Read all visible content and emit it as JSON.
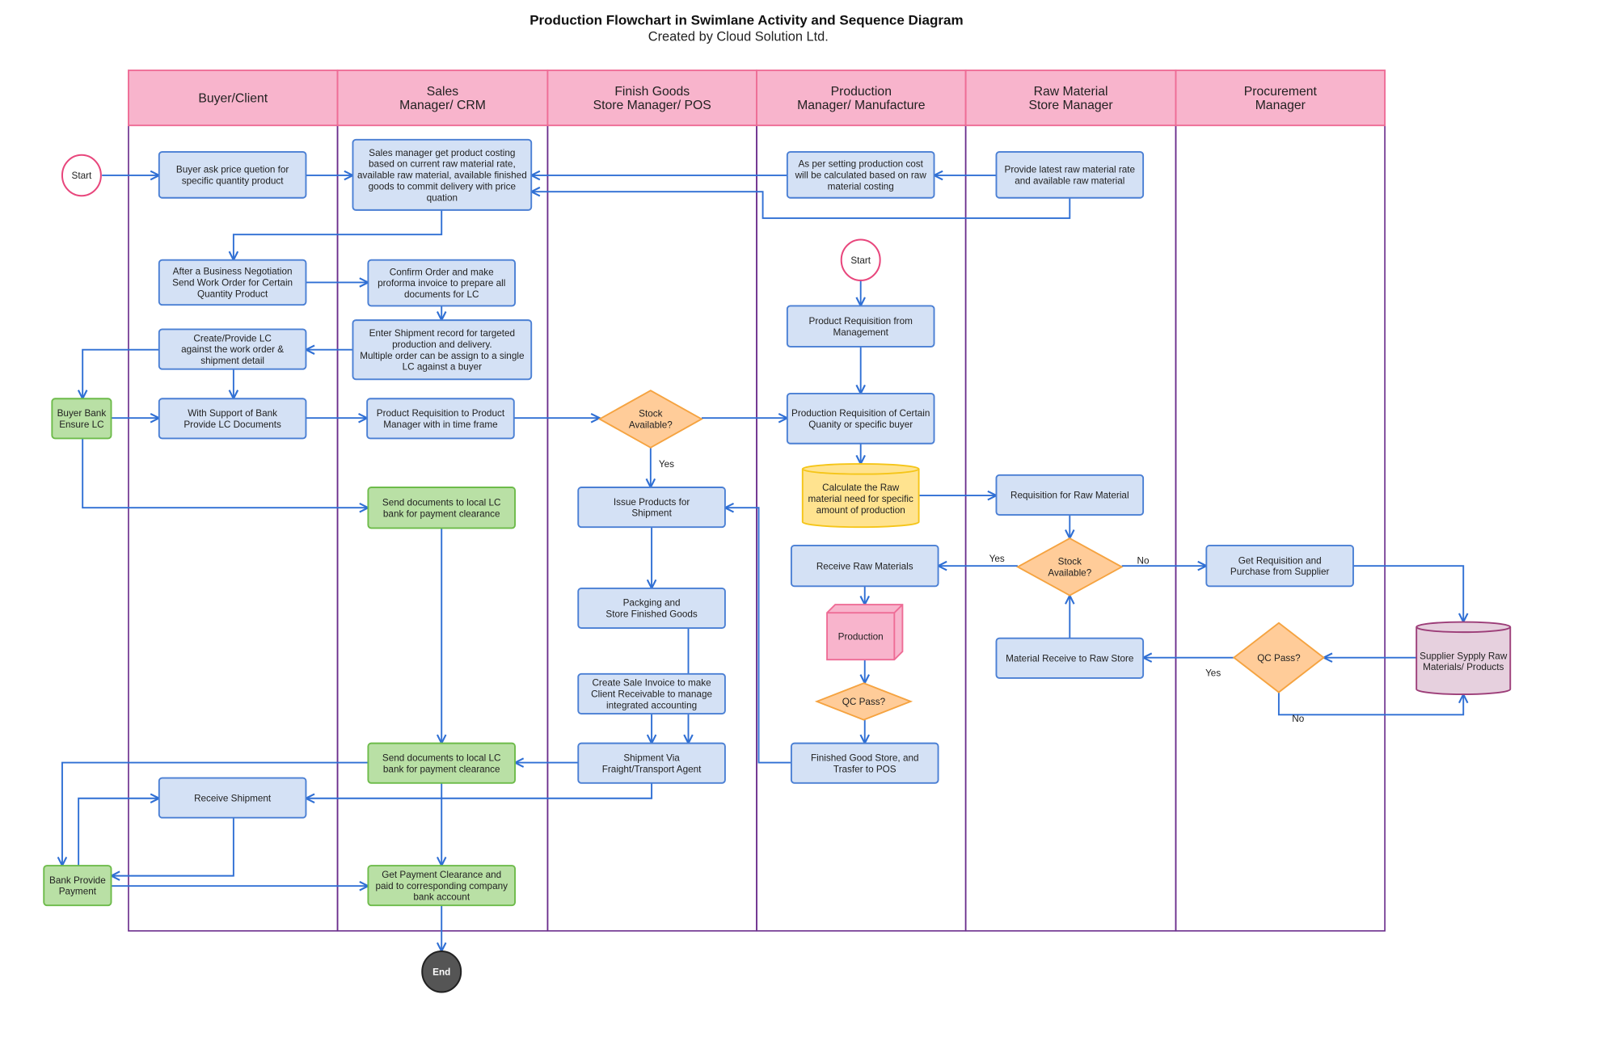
{
  "title": "Production Flowchart in Swimlane Activity and Sequence Diagram",
  "subtitle": "Created by Cloud Solution Ltd.",
  "colors": {
    "lane_header": "#f8b4cc",
    "lane_border": "#6a2d8c",
    "process": "#d4e1f5",
    "bank_step": "#b9e0a5",
    "decision": "#ffcc99",
    "edge": "#2f6fd4",
    "start": "#e8467c",
    "end": "#555555",
    "data_store": "#ffe38f",
    "supplier": "#e6d0de",
    "production": "#f8b4cc"
  },
  "lanes": [
    {
      "label": [
        "Buyer/Client"
      ]
    },
    {
      "label": [
        "Sales",
        "Manager/ CRM"
      ]
    },
    {
      "label": [
        "Finish Goods",
        "Store Manager/ POS"
      ]
    },
    {
      "label": [
        "Production",
        "Manager/ Manufacture"
      ]
    },
    {
      "label": [
        "Raw Material",
        "Store Manager"
      ]
    },
    {
      "label": [
        "Procurement",
        "Manager"
      ]
    }
  ],
  "nodes": {
    "start1": {
      "kind": "start",
      "text": [
        "Start"
      ]
    },
    "n1": {
      "kind": "process",
      "text": [
        "Buyer ask price quetion for",
        "specific quantity product"
      ]
    },
    "n2": {
      "kind": "process",
      "text": [
        "Sales manager get product costing",
        "based on current raw material rate,",
        "available raw material, available finished",
        "goods to commit delivery with price",
        "quation"
      ]
    },
    "n3": {
      "kind": "process",
      "text": [
        "As per setting production cost",
        "will be calculated based on raw",
        "material costing"
      ]
    },
    "n4": {
      "kind": "process",
      "text": [
        "Provide latest raw material rate",
        "and available raw material"
      ]
    },
    "n5": {
      "kind": "process",
      "text": [
        "After a Business Negotiation",
        "Send Work Order for Certain",
        "Quantity Product"
      ]
    },
    "n6": {
      "kind": "process",
      "text": [
        "Confirm Order and make",
        "proforma invoice to prepare all",
        "documents for LC"
      ]
    },
    "n7": {
      "kind": "process",
      "text": [
        "Enter Shipment record for targeted",
        "production and delivery.",
        "Multiple order can be assign to a single",
        "LC against a buyer"
      ]
    },
    "n8": {
      "kind": "process",
      "text": [
        "Create/Provide LC",
        "against the work order &",
        "shipment detail"
      ]
    },
    "n9": {
      "kind": "bank",
      "text": [
        "Buyer Bank",
        "Ensure LC"
      ]
    },
    "n10": {
      "kind": "process",
      "text": [
        "With Support of Bank",
        "Provide LC Documents"
      ]
    },
    "n11": {
      "kind": "process",
      "text": [
        "Product Requisition to Product",
        "Manager with in time frame"
      ]
    },
    "d1": {
      "kind": "decision",
      "text": [
        "Stock",
        "Available?"
      ]
    },
    "n12": {
      "kind": "process",
      "text": [
        "Production Requisition of Certain",
        "Quanity or specific buyer"
      ]
    },
    "start2": {
      "kind": "start",
      "text": [
        "Start"
      ]
    },
    "n13": {
      "kind": "process",
      "text": [
        "Product Requisition from",
        "Management"
      ]
    },
    "cyl1": {
      "kind": "datastore",
      "text": [
        "Calculate the Raw",
        "material need for specific",
        "amount of production"
      ]
    },
    "n14": {
      "kind": "process",
      "text": [
        "Requisition for Raw Material"
      ]
    },
    "n15": {
      "kind": "bank",
      "text": [
        "Send documents to local LC",
        "bank for payment clearance"
      ]
    },
    "n16": {
      "kind": "process",
      "text": [
        "Issue Products for",
        "Shipment"
      ]
    },
    "n17": {
      "kind": "process",
      "text": [
        "Receive Raw Materials"
      ]
    },
    "d2": {
      "kind": "decision",
      "text": [
        "Stock",
        "Available?"
      ]
    },
    "n18": {
      "kind": "process",
      "text": [
        "Get Requisition and",
        "Purchase from Supplier"
      ]
    },
    "n19": {
      "kind": "process",
      "text": [
        "Packging and",
        "Store Finished Goods"
      ]
    },
    "box3d": {
      "kind": "production",
      "text": [
        "Production"
      ]
    },
    "cyl2": {
      "kind": "supplier",
      "text": [
        "Supplier Sypply Raw",
        "Materials/ Products"
      ]
    },
    "d3": {
      "kind": "decision",
      "text": [
        "QC Pass?"
      ]
    },
    "n20": {
      "kind": "process",
      "text": [
        "Material Receive to Raw Store"
      ]
    },
    "n21": {
      "kind": "process",
      "text": [
        "Create Sale Invoice to make",
        "Client Receivable to manage",
        "integrated accounting"
      ]
    },
    "d4": {
      "kind": "decision",
      "text": [
        "QC Pass?"
      ]
    },
    "n22": {
      "kind": "bank",
      "text": [
        "Send documents to local LC",
        "bank for payment clearance"
      ]
    },
    "n23": {
      "kind": "process",
      "text": [
        "Shipment Via",
        "Fraight/Transport Agent"
      ]
    },
    "n24": {
      "kind": "process",
      "text": [
        "Finished Good Store, and",
        "Trasfer to POS"
      ]
    },
    "n25": {
      "kind": "process",
      "text": [
        "Receive Shipment"
      ]
    },
    "n26": {
      "kind": "bank",
      "text": [
        "Bank Provide",
        "Payment"
      ]
    },
    "n27": {
      "kind": "bank",
      "text": [
        "Get Payment Clearance and",
        "paid to corresponding company",
        "bank account"
      ]
    },
    "end": {
      "kind": "end",
      "text": [
        "End"
      ]
    }
  },
  "edge_labels": {
    "d1_yes": "Yes",
    "d2_yes": "Yes",
    "d2_no": "No",
    "d3_yes": "Yes",
    "d3_no": "No"
  }
}
